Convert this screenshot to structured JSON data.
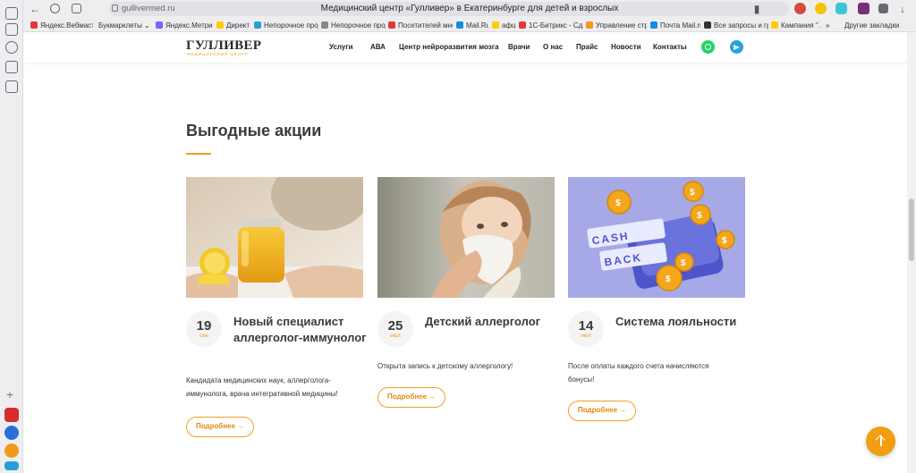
{
  "browser": {
    "url": "gullivermed.ru",
    "page_title": "Медицинский центр «Гулливер» в Екатеринбурге для детей и взрослых",
    "bookmarks": [
      {
        "label": "Яндекс.Вебмастер",
        "color": "#e53935"
      },
      {
        "label": "Букмарклеты ⌄",
        "color": "#eeeef1"
      },
      {
        "label": "Яндекс.Метрика",
        "color": "#7b61ff"
      },
      {
        "label": "Директ",
        "color": "#ffcc00"
      },
      {
        "label": "Непорочное прод...",
        "color": "#2a9fd6"
      },
      {
        "label": "Непорочное прод...",
        "color": "#888888"
      },
      {
        "label": "Посетителей много...",
        "color": "#e53935"
      },
      {
        "label": "Mail.Ru",
        "color": "#168de2"
      },
      {
        "label": "афц",
        "color": "#ffcc00"
      },
      {
        "label": "1С-Битрикс - Сда...",
        "color": "#e53935"
      },
      {
        "label": "Управление стру...",
        "color": "#f09a1a"
      },
      {
        "label": "Почта Mail.ru",
        "color": "#168de2"
      },
      {
        "label": "Все запросы и гр...",
        "color": "#333333"
      },
      {
        "label": "Кампания ''...",
        "color": "#ffcc00"
      }
    ],
    "other_bookmarks": "Другие закладки"
  },
  "site": {
    "logo": "ГУЛЛИВЕР",
    "logo_sub": "МЕДИЦИНСКИЙ ЦЕНТР",
    "menu": [
      "Услуги",
      "АВА",
      "Центр нейроразвития мозга",
      "Врачи",
      "О нас",
      "Прайс",
      "Новости",
      "Контакты"
    ],
    "colors": {
      "accent": "#f0a020",
      "whatsapp": "#25d366",
      "telegram": "#2aa3dd"
    }
  },
  "promo": {
    "title": "Выгодные акции",
    "cards": [
      {
        "day": "19",
        "month": "сен",
        "title": "Новый специалист аллерголог-иммунолог",
        "text": "Кандидата медицинских наук, аллерголога-иммунолога, врача интегративной медицины!",
        "button": "Подробнее →"
      },
      {
        "day": "25",
        "month": "июл",
        "title": "Детский аллерголог",
        "text": "Открыта запись к детскому аллергологу!",
        "button": "Подробнее →"
      },
      {
        "day": "14",
        "month": "июл",
        "title": "Система лояльности",
        "text": "После оплаты каждого счета начисляются бонусы!",
        "button": "Подробнее →",
        "image_text": [
          "CASH",
          "BACK"
        ]
      }
    ]
  }
}
